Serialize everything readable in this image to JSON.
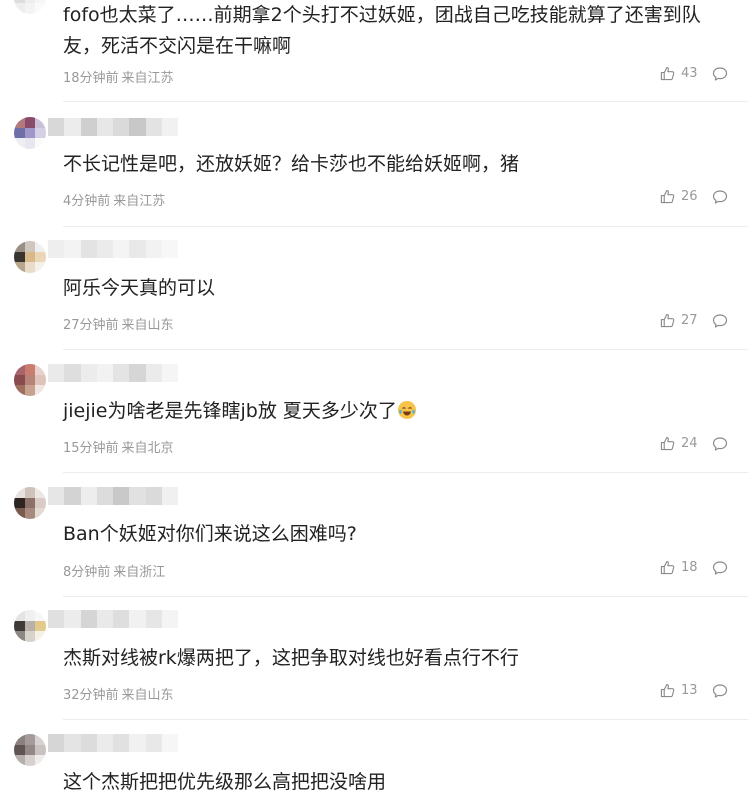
{
  "comments": [
    {
      "text": "fofo也太菜了……前期拿2个头打不过妖姬，团战自己吃技能就算了还害到队友，死活不交闪是在干嘛啊",
      "time": "18分钟前",
      "location": "来自江苏",
      "likes": "43",
      "avatar_colors": [
        "#c9a39a",
        "#e7d6d2",
        "#f3f3f3",
        "#ddd",
        "#eee",
        "#f6f6f6",
        "#eee",
        "#f4f4f4",
        "#fafafa"
      ],
      "name_colors": [
        "#e2e2e2",
        "#f0f0f0",
        "#d9d9d9",
        "#efefef",
        "#e4e4e4",
        "#f5f5f5",
        "#dcdcdc",
        "#f2f2f2"
      ]
    },
    {
      "text": "不长记性是吧，还放妖姬？给卡莎也不能给妖姬啊，猪",
      "time": "4分钟前",
      "location": "来自江苏",
      "likes": "26",
      "avatar_colors": [
        "#b07a7f",
        "#8a4a6a",
        "#c9c0d8",
        "#6e6ea8",
        "#a196c8",
        "#d5d0e6",
        "#f0eef5",
        "#e8e6f0",
        "#fafafa"
      ],
      "name_colors": [
        "#d8d8d8",
        "#ececec",
        "#cfcfcf",
        "#e7e7e7",
        "#dadada",
        "#c8c8c8",
        "#e3e3e3",
        "#f1f1f1"
      ]
    },
    {
      "text": "阿乐今天真的可以",
      "time": "27分钟前",
      "location": "来自山东",
      "likes": "27",
      "avatar_colors": [
        "#9a8f86",
        "#cfc6bd",
        "#efefef",
        "#3a3531",
        "#d9b98a",
        "#ecd6b8",
        "#b8a58c",
        "#e9dcc8",
        "#f4f0ea"
      ],
      "name_colors": [
        "#eeeeee",
        "#f3f3f3",
        "#e3e3e3",
        "#ebebeb",
        "#f4f4f4",
        "#e9e9e9",
        "#f2f2f2",
        "#f7f7f7"
      ]
    },
    {
      "text": "jiejie为啥老是先锋瞎jb放 夏天多少次了",
      "time": "15分钟前",
      "location": "来自北京",
      "likes": "24",
      "avatar_colors": [
        "#a8636b",
        "#c97d6f",
        "#e7d2cd",
        "#8a4a4e",
        "#b78278",
        "#e0c3bb",
        "#9c6f5e",
        "#c7a38f",
        "#efe6e2"
      ],
      "name_colors": [
        "#eaeaea",
        "#dedede",
        "#ececec",
        "#f2f2f2",
        "#e4e4e4",
        "#d6d6d6",
        "#ebebeb",
        "#f5f5f5"
      ]
    },
    {
      "text": "Ban个妖姬对你们来说这么困难吗?",
      "time": "8分钟前",
      "location": "来自浙江",
      "likes": "18",
      "avatar_colors": [
        "#e8e2de",
        "#cfc2ba",
        "#ece7e4",
        "#2e2422",
        "#8c7168",
        "#d9ccc5",
        "#7a5a4f",
        "#a8897d",
        "#e4dad4"
      ],
      "name_colors": [
        "#e6e6e6",
        "#d3d3d3",
        "#ededed",
        "#dcdcdc",
        "#c9c9c9",
        "#e1e1e1",
        "#dadada",
        "#f0f0f0"
      ]
    },
    {
      "text": "杰斯对线被rk爆两把了，这把争取对线也好看点行不行",
      "time": "32分钟前",
      "location": "来自山东",
      "likes": "13",
      "avatar_colors": [
        "#e4e4e4",
        "#f0f0f0",
        "#f7f7f7",
        "#3d3a38",
        "#b8b1aa",
        "#e3c98a",
        "#8c8782",
        "#d8d2cc",
        "#f5f1e6"
      ],
      "name_colors": [
        "#e0e0e0",
        "#ececec",
        "#d5d5d5",
        "#e9e9e9",
        "#dedede",
        "#f1f1f1",
        "#e6e6e6",
        "#f4f4f4"
      ]
    },
    {
      "text": "这个杰斯把把优先级那么高把把没啥用",
      "time": "",
      "location": "",
      "likes": "",
      "avatar_colors": [
        "#8b8180",
        "#a59b9a",
        "#d8d3d2",
        "#5e5552",
        "#938886",
        "#c9c2c0",
        "#b6aeac",
        "#d6d0ce",
        "#efecea"
      ],
      "name_colors": [
        "#d6d6d6",
        "#e4e4e4",
        "#dcdcdc",
        "#ebebeb",
        "#e1e1e1",
        "#f1f1f1",
        "#e8e8e8",
        "#f6f6f6"
      ]
    }
  ]
}
